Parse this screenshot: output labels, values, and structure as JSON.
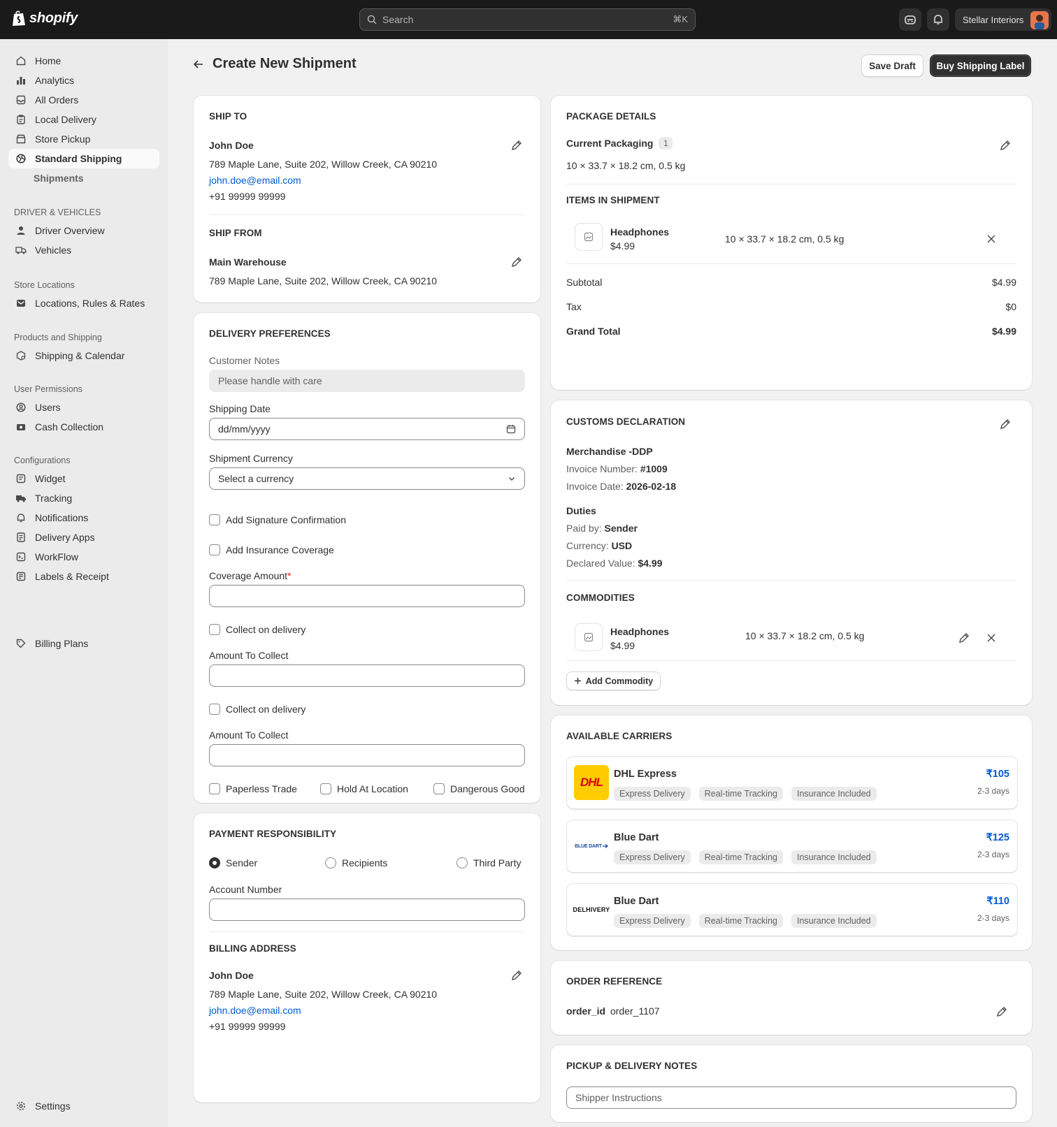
{
  "topbar": {
    "logo_text": "shopify",
    "search_placeholder": "Search",
    "search_shortcut": "⌘K",
    "store_name": "Stellar Interiors"
  },
  "sidebar": {
    "items": [
      {
        "label": "Home",
        "icon": "home-icon"
      },
      {
        "label": "Analytics",
        "icon": "bar-chart-icon"
      },
      {
        "label": "All Orders",
        "icon": "inbox-icon"
      },
      {
        "label": "Local Delivery",
        "icon": "clipboard-icon"
      },
      {
        "label": "Store Pickup",
        "icon": "store-icon"
      },
      {
        "label": "Standard Shipping",
        "icon": "globe-icon"
      },
      {
        "label": "Shipments"
      }
    ],
    "sections": {
      "drivers": "DRIVER & VEHICLES",
      "driver_overview": "Driver Overview",
      "vehicles": "Vehicles",
      "store_locations": "Store Locations",
      "locations_rules": "Locations, Rules & Rates",
      "products_shipping": "Products and Shipping",
      "shipping_calendar": "Shipping & Calendar",
      "user_permissions": "User Permissions",
      "users": "Users",
      "cash_collection": "Cash Collection",
      "configurations": "Configurations",
      "widget": "Widget",
      "tracking": "Tracking",
      "notifications": "Notifications",
      "delivery_apps": "Delivery Apps",
      "workflow": "WorkFlow",
      "labels_receipt": "Labels & Receipt",
      "billing_plans": "Billing Plans",
      "settings": "Settings"
    }
  },
  "page": {
    "title": "Create New Shipment",
    "save_draft": "Save Draft",
    "buy_label": "Buy Shipping Label"
  },
  "ship_to": {
    "heading": "SHIP TO",
    "name": "John Doe",
    "address": "789 Maple Lane, Suite 202, Willow Creek, CA 90210",
    "email": "john.doe@email.com",
    "phone": "+91 99999 99999"
  },
  "ship_from": {
    "heading": "SHIP FROM",
    "name": "Main Warehouse",
    "address": "789 Maple Lane, Suite 202, Willow Creek, CA 90210"
  },
  "delivery": {
    "heading": "DELIVERY PREFERENCES",
    "customer_notes_label": "Customer Notes",
    "customer_notes_value": "Please handle with care",
    "shipping_date_label": "Shipping Date",
    "shipping_date_placeholder": "dd/mm/yyyy",
    "currency_label": "Shipment Currency",
    "currency_value": "Select a currency",
    "signature": "Add Signature Confirmation",
    "insurance": "Add Insurance Coverage",
    "coverage_label": "Coverage Amount",
    "required_mark": "*",
    "collect1": "Collect on delivery",
    "amount1_label": "Amount To Collect",
    "collect2": "Collect on delivery",
    "amount2_label": "Amount To Collect",
    "paperless": "Paperless Trade",
    "hold": "Hold At Location",
    "dangerous": "Dangerous Good"
  },
  "payment": {
    "heading": "PAYMENT RESPONSIBILITY",
    "options": [
      "Sender",
      "Recipients",
      "Third Party"
    ],
    "selected": "Sender",
    "account_label": "Account Number"
  },
  "billing": {
    "heading": "BILLING ADDRESS",
    "name": "John Doe",
    "address": "789 Maple Lane, Suite 202, Willow Creek, CA 90210",
    "email": "john.doe@email.com",
    "phone": "+91 99999 99999"
  },
  "package": {
    "heading": "PACKAGE DETAILS",
    "packaging_label": "Current Packaging",
    "packaging_count": "1",
    "dimensions": "10 × 33.7 × 18.2 cm, 0.5 kg",
    "items_heading": "ITEMS IN SHIPMENT",
    "item_name": "Headphones",
    "item_price": "$4.99",
    "item_dims": "10 × 33.7 × 18.2 cm, 0.5 kg",
    "subtotal_label": "Subtotal",
    "subtotal": "$4.99",
    "tax_label": "Tax",
    "tax": "$0",
    "grand_label": "Grand Total",
    "grand": "$4.99"
  },
  "customs": {
    "heading": "CUSTOMS DECLARATION",
    "type": "Merchandise -DDP",
    "invoice_number_label": "Invoice Number:",
    "invoice_number": "#1009",
    "invoice_date_label": "Invoice Date:",
    "invoice_date": "2026-02-18",
    "duties_heading": "Duties",
    "paid_by_label": "Paid by:",
    "paid_by": "Sender",
    "currency_label": "Currency:",
    "currency": "USD",
    "declared_label": "Declared Value:",
    "declared": "$4.99",
    "commodities_heading": "COMMODITIES",
    "commodity_name": "Headphones",
    "commodity_price": "$4.99",
    "commodity_dims": "10 × 33.7 × 18.2 cm, 0.5 kg",
    "add_commodity": "Add Commodity"
  },
  "carriers": {
    "heading": "AVAILABLE CARRIERS",
    "list": [
      {
        "name": "DHL Express",
        "logo_text": "DHL",
        "price": "₹105",
        "days": "2-3 days",
        "tags": [
          "Express Delivery",
          "Real-time Tracking",
          "Insurance Included"
        ]
      },
      {
        "name": "Blue Dart",
        "logo_text": "BLUE DART",
        "price": "₹125",
        "days": "2-3 days",
        "tags": [
          "Express Delivery",
          "Real-time Tracking",
          "Insurance Included"
        ]
      },
      {
        "name": "Blue Dart",
        "logo_text": "DELHIVERY",
        "price": "₹110",
        "days": "2-3 days",
        "tags": [
          "Express Delivery",
          "Real-time Tracking",
          "Insurance Included"
        ]
      }
    ]
  },
  "order_ref": {
    "heading": "ORDER REFERENCE",
    "key": "order_id",
    "value": "order_1107"
  },
  "notes": {
    "heading": "PICKUP & DELIVERY NOTES",
    "placeholder": "Shipper Instructions"
  },
  "colors": {
    "topbar": "#1a1a1a",
    "link": "#005bd3",
    "dhl_yellow": "#ffcc00",
    "dhl_red": "#d40511"
  }
}
